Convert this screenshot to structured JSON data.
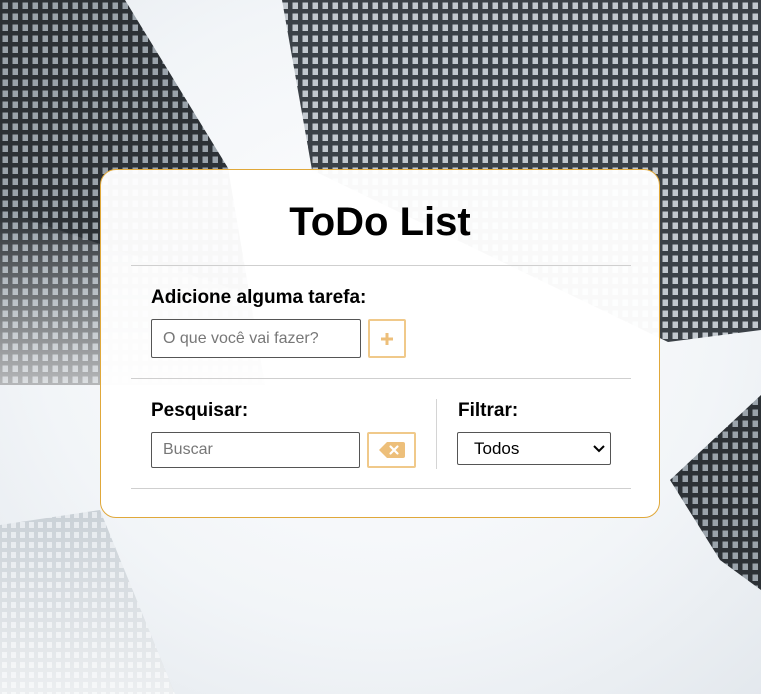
{
  "app": {
    "title": "ToDo List"
  },
  "add_section": {
    "label": "Adicione alguma tarefa:",
    "input_placeholder": "O que você vai fazer?",
    "input_value": "",
    "add_icon": "plus-icon"
  },
  "search_section": {
    "label": "Pesquisar:",
    "input_placeholder": "Buscar",
    "input_value": "",
    "clear_icon": "backspace-icon"
  },
  "filter_section": {
    "label": "Filtrar:",
    "selected": "Todos",
    "dropdown_icon": "chevron-down-icon"
  },
  "colors": {
    "accent": "#e0a83a",
    "button_border": "#f0c98a",
    "button_icon": "#edbf7a"
  }
}
